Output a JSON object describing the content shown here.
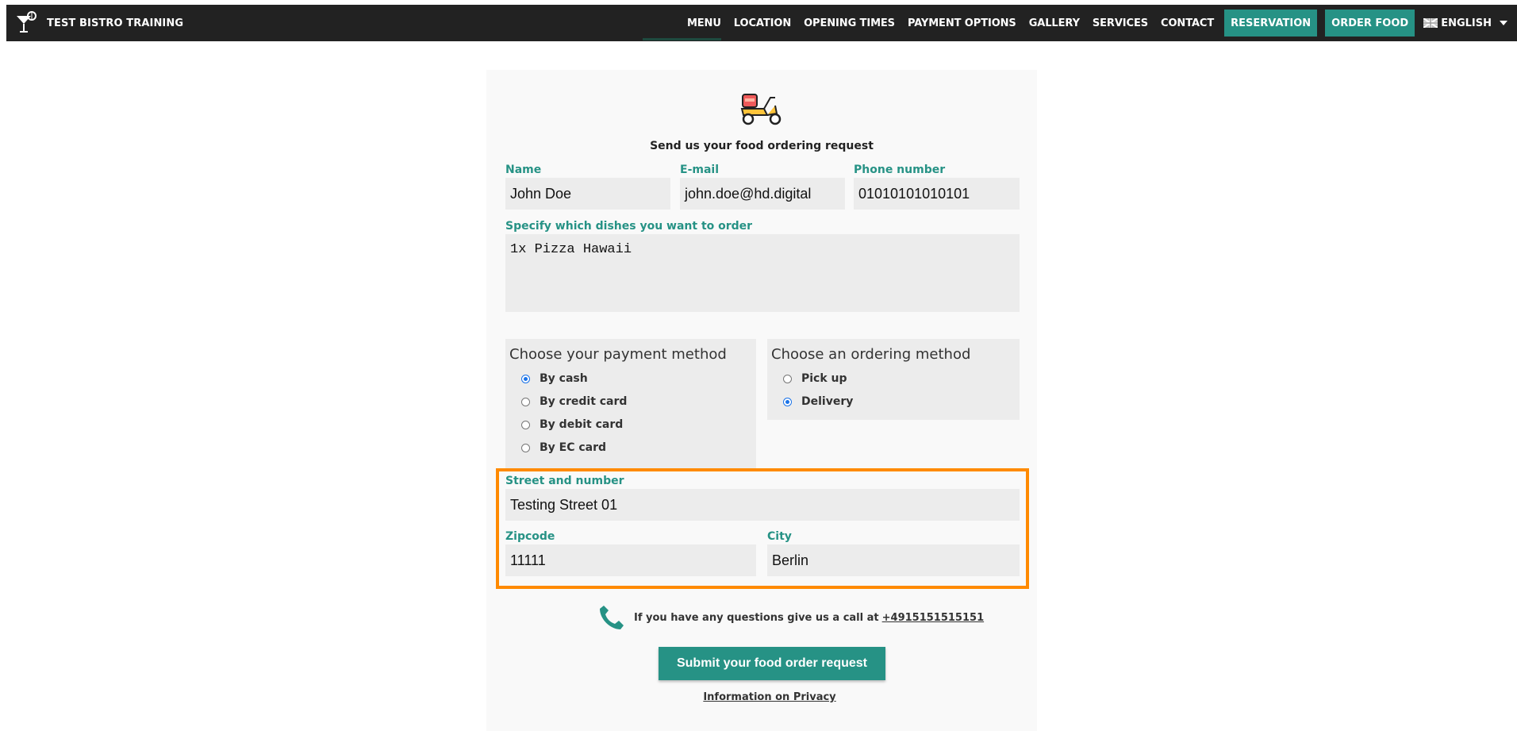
{
  "nav": {
    "brand": "TEST BISTRO TRAINING",
    "logo_icon": "cocktail-glass-icon",
    "items": [
      "MENU",
      "LOCATION",
      "OPENING TIMES",
      "PAYMENT OPTIONS",
      "GALLERY",
      "SERVICES",
      "CONTACT"
    ],
    "reservation": "RESERVATION",
    "order_food": "ORDER FOOD",
    "language": "ENGLISH",
    "colors": {
      "bar": "#222222",
      "accent": "#269285"
    }
  },
  "form": {
    "intro": "Send us your food ordering request",
    "name_label": "Name",
    "name_value": "John Doe",
    "email_label": "E-mail",
    "email_value": "john.doe@hd.digital",
    "phone_label": "Phone number",
    "phone_value": "01010101010101",
    "dishes_label": "Specify which dishes you want to order",
    "dishes_value": "1x Pizza Hawaii",
    "payment": {
      "title": "Choose your payment method",
      "options": [
        "By cash",
        "By credit card",
        "By debit card",
        "By EC card"
      ],
      "selected": "By cash"
    },
    "ordering": {
      "title": "Choose an ordering method",
      "options": [
        "Pick up",
        "Delivery"
      ],
      "selected": "Delivery"
    },
    "street_label": "Street and number",
    "street_value": "Testing Street 01",
    "zip_label": "Zipcode",
    "zip_value": "11111",
    "city_label": "City",
    "city_value": "Berlin",
    "question_text": "If you have any questions give us a call at",
    "phone_link": "+4915151515151",
    "submit": "Submit your food order request",
    "privacy": "Information on Privacy",
    "highlight_color": "#ff8a00"
  }
}
